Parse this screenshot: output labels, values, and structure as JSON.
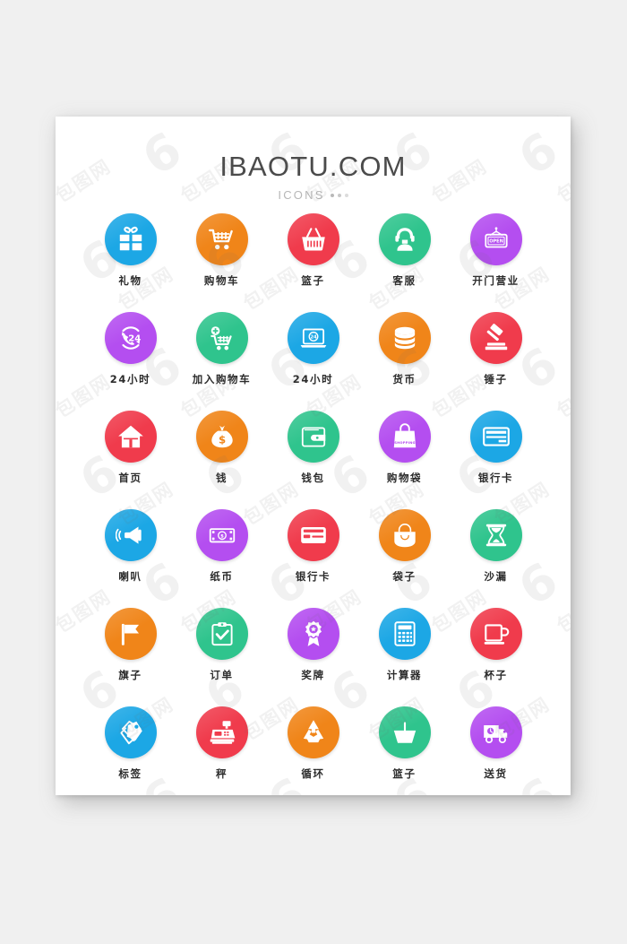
{
  "page": {
    "background_color": "#f0f0f0",
    "card_color": "#ffffff"
  },
  "header": {
    "title": "IBAOTU.COM",
    "subtitle": "ICONS"
  },
  "palette": {
    "blue": "#1CA7E5",
    "orange": "#F08519",
    "red": "#F03B4C",
    "green": "#2FC48D",
    "purple": "#B44EF0",
    "label_text": "#2b2b2b",
    "title_text": "#4b4b4b",
    "subtitle_text": "#b7b7b7"
  },
  "watermark": {
    "mark": "包图网",
    "glyph": "6"
  },
  "grid": {
    "columns": 5,
    "rows": 6,
    "icons": [
      {
        "label": "礼物",
        "icon": "gift-icon",
        "color": "#1CA7E5"
      },
      {
        "label": "购物车",
        "icon": "shopping-cart-icon",
        "color": "#F08519"
      },
      {
        "label": "篮子",
        "icon": "shopping-basket-icon",
        "color": "#F03B4C"
      },
      {
        "label": "客服",
        "icon": "customer-service-icon",
        "color": "#2FC48D"
      },
      {
        "label": "开门营业",
        "icon": "open-sign-icon",
        "color": "#B44EF0"
      },
      {
        "label": "24小时",
        "icon": "phone-24h-icon",
        "color": "#B44EF0"
      },
      {
        "label": "加入购物车",
        "icon": "add-to-cart-icon",
        "color": "#2FC48D"
      },
      {
        "label": "24小时",
        "icon": "laptop-24h-icon",
        "color": "#1CA7E5"
      },
      {
        "label": "货币",
        "icon": "coins-stack-icon",
        "color": "#F08519"
      },
      {
        "label": "锤子",
        "icon": "gavel-icon",
        "color": "#F03B4C"
      },
      {
        "label": "首页",
        "icon": "home-icon",
        "color": "#F03B4C"
      },
      {
        "label": "钱",
        "icon": "money-bag-icon",
        "color": "#F08519"
      },
      {
        "label": "钱包",
        "icon": "wallet-icon",
        "color": "#2FC48D"
      },
      {
        "label": "购物袋",
        "icon": "shopping-bag-icon",
        "color": "#B44EF0"
      },
      {
        "label": "银行卡",
        "icon": "credit-card-icon",
        "color": "#1CA7E5"
      },
      {
        "label": "喇叭",
        "icon": "megaphone-icon",
        "color": "#1CA7E5"
      },
      {
        "label": "纸币",
        "icon": "banknote-icon",
        "color": "#B44EF0"
      },
      {
        "label": "银行卡",
        "icon": "bank-card-icon",
        "color": "#F03B4C"
      },
      {
        "label": "袋子",
        "icon": "handbag-icon",
        "color": "#F08519"
      },
      {
        "label": "沙漏",
        "icon": "hourglass-icon",
        "color": "#2FC48D"
      },
      {
        "label": "旗子",
        "icon": "flag-icon",
        "color": "#F08519"
      },
      {
        "label": "订单",
        "icon": "clipboard-check-icon",
        "color": "#2FC48D"
      },
      {
        "label": "奖牌",
        "icon": "award-ribbon-icon",
        "color": "#B44EF0"
      },
      {
        "label": "计算器",
        "icon": "calculator-icon",
        "color": "#1CA7E5"
      },
      {
        "label": "杯子",
        "icon": "mug-icon",
        "color": "#F03B4C"
      },
      {
        "label": "标签",
        "icon": "tags-icon",
        "color": "#1CA7E5"
      },
      {
        "label": "秤",
        "icon": "cash-register-icon",
        "color": "#F03B4C"
      },
      {
        "label": "循环",
        "icon": "recycle-icon",
        "color": "#F08519"
      },
      {
        "label": "篮子",
        "icon": "basket-icon",
        "color": "#2FC48D"
      },
      {
        "label": "送货",
        "icon": "delivery-truck-icon",
        "color": "#B44EF0"
      }
    ]
  },
  "icon_badges": {
    "open_sign_text": "OPEN",
    "hours_24": "24",
    "shopping_bag_text": "SHOPPING",
    "money_symbol": "$"
  }
}
